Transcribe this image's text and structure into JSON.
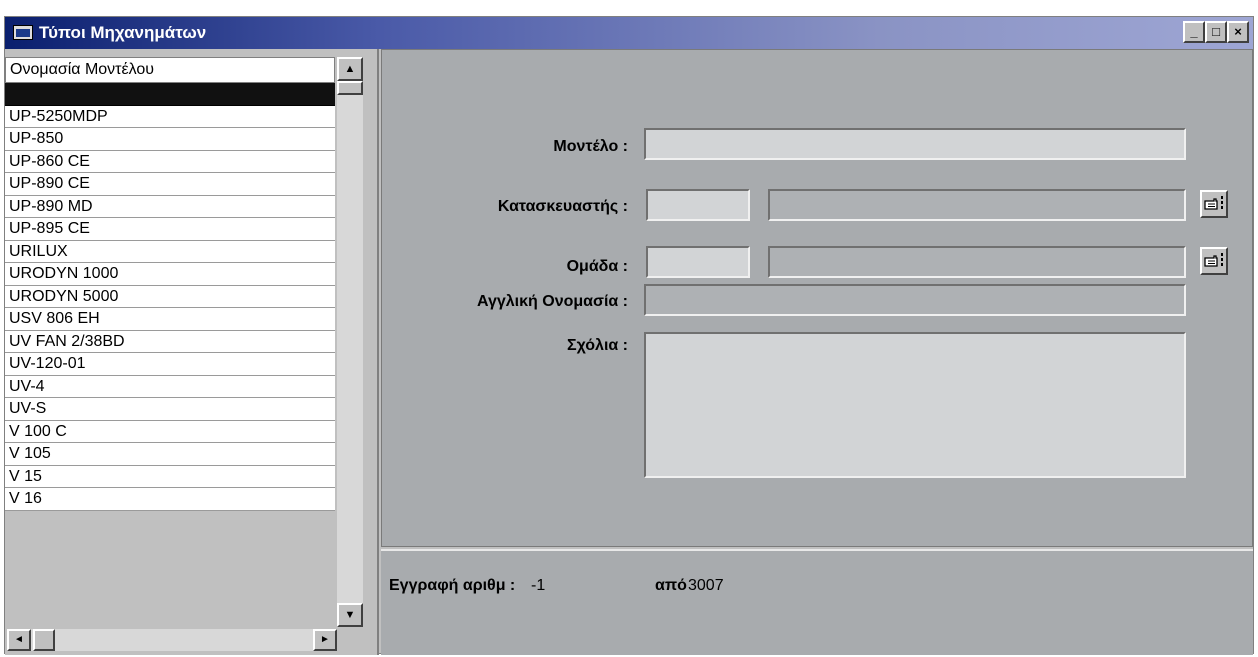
{
  "window": {
    "title": "Τύποι Μηχανημάτων",
    "minimize_label": "_",
    "maximize_label": "□",
    "close_label": "×"
  },
  "list": {
    "header": "Ονομασία Μοντέλου",
    "rows": [
      "",
      "UP-5250MDP",
      "UP-850",
      "UP-860 CE",
      "UP-890 CE",
      "UP-890 MD",
      "UP-895 CE",
      "URILUX",
      "URODYN 1000",
      "URODYN 5000",
      "USV 806 EH",
      "UV FAN 2/38BD",
      "UV-120-01",
      "UV-4",
      "UV-S",
      "V 100 C",
      "V 105",
      "V 15",
      "V 16"
    ],
    "scroll_up_label": "▲",
    "scroll_down_label": "▼",
    "scroll_left_label": "◄",
    "scroll_right_label": "►"
  },
  "form": {
    "model_label": "Μοντέλο :",
    "model_value": "",
    "manufacturer_label": "Κατασκευαστής :",
    "manufacturer_code": "",
    "manufacturer_name": "",
    "group_label": "Ομάδα :",
    "group_code": "",
    "group_name": "",
    "english_name_label": "Αγγλική Ονομασία :",
    "english_name_value": "",
    "comments_label": "Σχόλια :",
    "comments_value": ""
  },
  "status": {
    "record_label": "Εγγραφή αριθμ :",
    "record_value": "-1",
    "of_label": "από",
    "total_value": "3007"
  }
}
